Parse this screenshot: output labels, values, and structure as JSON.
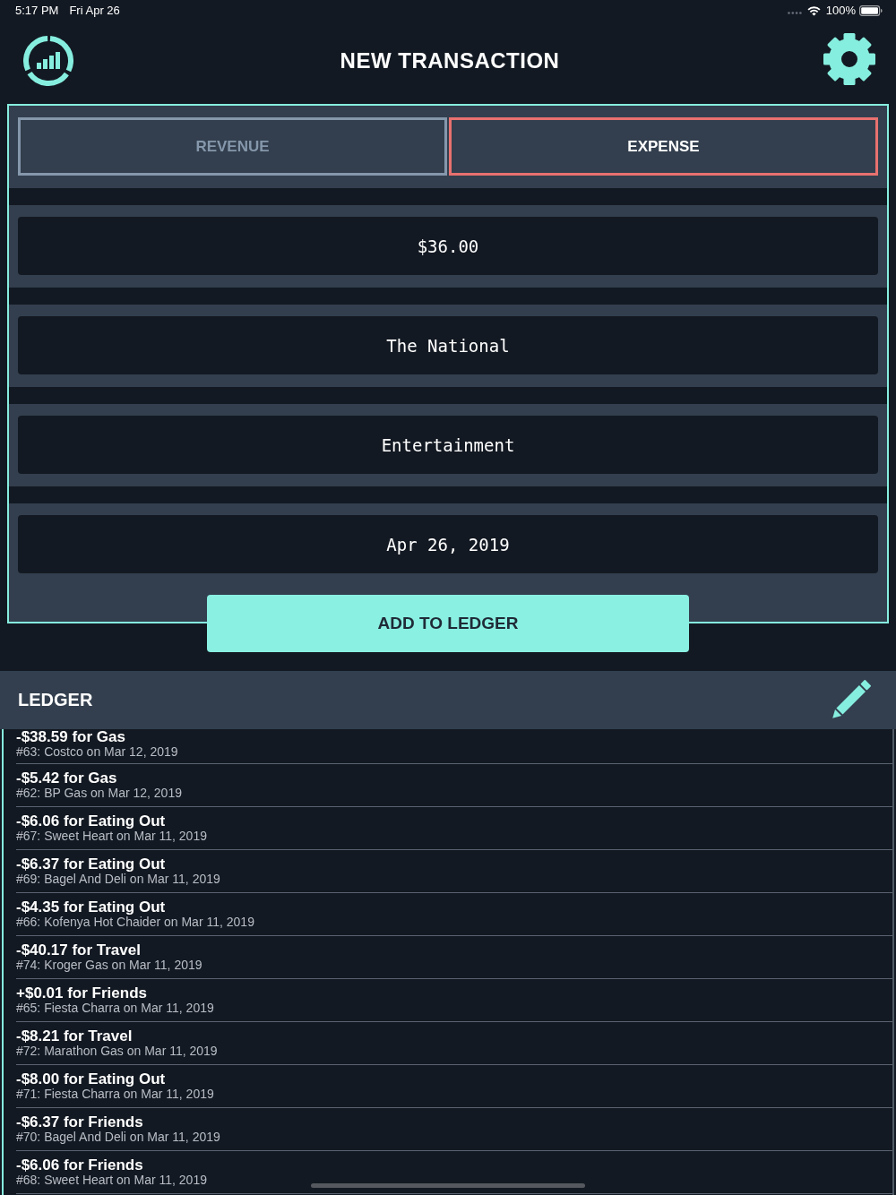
{
  "status_bar": {
    "time": "5:17 PM",
    "date": "Fri Apr 26",
    "battery": "100%"
  },
  "header": {
    "title": "NEW TRANSACTION"
  },
  "type_tabs": [
    {
      "label": "REVENUE",
      "selected": false
    },
    {
      "label": "EXPENSE",
      "selected": true
    }
  ],
  "fields": [
    {
      "value": "$36.00"
    },
    {
      "value": "The National"
    },
    {
      "value": "Entertainment"
    },
    {
      "value": "Apr 26, 2019"
    }
  ],
  "add_button": {
    "label": "ADD TO LEDGER"
  },
  "ledger": {
    "title": "LEDGER",
    "entries": [
      {
        "title": "-$38.59 for Gas",
        "detail": "#63: Costco on Mar 12, 2019"
      },
      {
        "title": "-$5.42 for Gas",
        "detail": "#62: BP Gas on Mar 12, 2019"
      },
      {
        "title": "-$6.06 for Eating Out",
        "detail": "#67: Sweet Heart on Mar 11, 2019"
      },
      {
        "title": "-$6.37 for Eating Out",
        "detail": "#69: Bagel And Deli on Mar 11, 2019"
      },
      {
        "title": "-$4.35 for Eating Out",
        "detail": "#66: Kofenya Hot Chaider on Mar 11, 2019"
      },
      {
        "title": "-$40.17 for Travel",
        "detail": "#74: Kroger Gas on Mar 11, 2019"
      },
      {
        "title": "+$0.01 for Friends",
        "detail": "#65: Fiesta Charra on Mar 11, 2019"
      },
      {
        "title": "-$8.21 for Travel",
        "detail": "#72: Marathon Gas on Mar 11, 2019"
      },
      {
        "title": "-$8.00 for Eating Out",
        "detail": "#71: Fiesta Charra on Mar 11, 2019"
      },
      {
        "title": "-$6.37 for Friends",
        "detail": "#70: Bagel And Deli on Mar 11, 2019"
      },
      {
        "title": "-$6.06 for Friends",
        "detail": "#68: Sweet Heart on Mar 11, 2019"
      }
    ]
  }
}
